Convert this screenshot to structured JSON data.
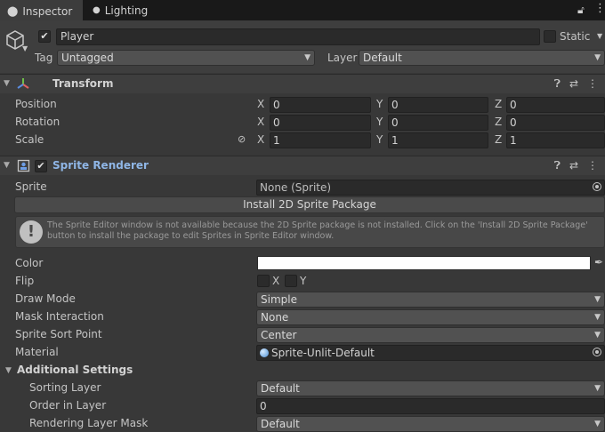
{
  "tabs": [
    {
      "label": "Inspector",
      "icon": "info-icon",
      "active": true
    },
    {
      "label": "Lighting",
      "icon": "lightbulb-icon",
      "active": false
    }
  ],
  "object": {
    "name": "Player",
    "active_checked": true,
    "static_label": "Static",
    "tag_label": "Tag",
    "tag_value": "Untagged",
    "layer_label": "Layer",
    "layer_value": "Default"
  },
  "transform": {
    "title": "Transform",
    "rows": [
      {
        "label": "Position",
        "x": "0",
        "y": "0",
        "z": "0"
      },
      {
        "label": "Rotation",
        "x": "0",
        "y": "0",
        "z": "0"
      },
      {
        "label": "Scale",
        "x": "1",
        "y": "1",
        "z": "1"
      }
    ],
    "axis": {
      "x": "X",
      "y": "Y",
      "z": "Z"
    }
  },
  "sprite_renderer": {
    "title": "Sprite Renderer",
    "enabled": true,
    "sprite_label": "Sprite",
    "sprite_value": "None (Sprite)",
    "install_button": "Install 2D Sprite Package",
    "help_text": "The Sprite Editor window is not available because the 2D Sprite package is not installed. Click on the 'Install 2D Sprite Package' button to install the package to edit Sprites in Sprite Editor window.",
    "color_label": "Color",
    "color_value": "#ffffff",
    "flip_label": "Flip",
    "flip_x": "X",
    "flip_y": "Y",
    "draw_mode_label": "Draw Mode",
    "draw_mode_value": "Simple",
    "mask_label": "Mask Interaction",
    "mask_value": "None",
    "sort_point_label": "Sprite Sort Point",
    "sort_point_value": "Center",
    "material_label": "Material",
    "material_value": "Sprite-Unlit-Default",
    "additional_label": "Additional Settings",
    "sorting_layer_label": "Sorting Layer",
    "sorting_layer_value": "Default",
    "order_label": "Order in Layer",
    "order_value": "0",
    "rendering_mask_label": "Rendering Layer Mask",
    "rendering_mask_value": "Default"
  },
  "colors": {
    "background": "#383838",
    "header": "#3e3e3e",
    "tabbar": "#191919",
    "title_blue": "#8fb6e6",
    "field": "#2a2a2a",
    "dropdown": "#515151"
  }
}
